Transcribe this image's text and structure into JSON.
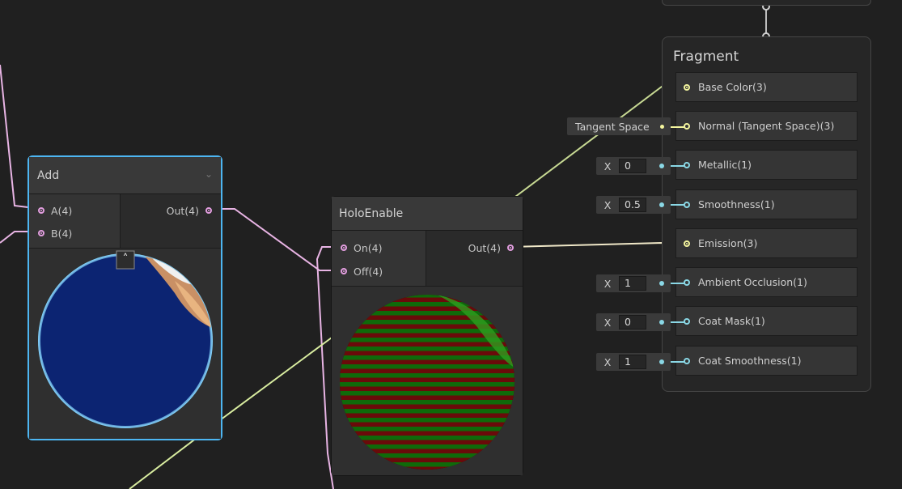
{
  "add_node": {
    "title": "Add",
    "inputs": [
      "A(4)",
      "B(4)"
    ],
    "output": "Out(4)"
  },
  "holo_node": {
    "title": "HoloEnable",
    "inputs": [
      "On(4)",
      "Off(4)"
    ],
    "output": "Out(4)"
  },
  "fragment": {
    "title": "Fragment",
    "slots": [
      "Base Color(3)",
      "Normal (Tangent Space)(3)",
      "Metallic(1)",
      "Smoothness(1)",
      "Emission(3)",
      "Ambient Occlusion(1)",
      "Coat Mask(1)",
      "Coat Smoothness(1)"
    ],
    "tangent_space_label": "Tangent Space",
    "x_label": "X",
    "inline_values": {
      "metallic": "0",
      "smoothness": "0.5",
      "ambient_occlusion": "1",
      "coat_mask": "0",
      "coat_smoothness": "1"
    }
  },
  "colors": {
    "background": "#202020",
    "node_body": "#2a2a2a",
    "selected_border": "#4db6f2",
    "vector4_port": "#e39ee0",
    "vector3_port": "#f4f59e",
    "float_port": "#8ad8e6",
    "wire_pink": "#e8b4e4",
    "wire_yellow": "#d9eda0"
  }
}
